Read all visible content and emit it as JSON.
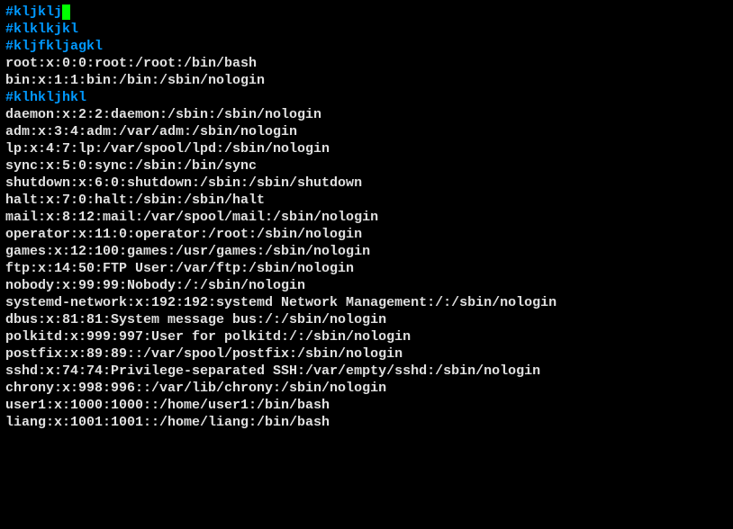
{
  "lines": [
    {
      "type": "comment",
      "text": "#kljklj",
      "hasCursor": true
    },
    {
      "type": "comment",
      "text": "#klklkjkl"
    },
    {
      "type": "comment",
      "text": "#kljfkljagkl"
    },
    {
      "type": "text",
      "text": "root:x:0:0:root:/root:/bin/bash"
    },
    {
      "type": "text",
      "text": "bin:x:1:1:bin:/bin:/sbin/nologin"
    },
    {
      "type": "comment",
      "text": "#klhkljhkl"
    },
    {
      "type": "text",
      "text": "daemon:x:2:2:daemon:/sbin:/sbin/nologin"
    },
    {
      "type": "text",
      "text": "adm:x:3:4:adm:/var/adm:/sbin/nologin"
    },
    {
      "type": "text",
      "text": "lp:x:4:7:lp:/var/spool/lpd:/sbin/nologin"
    },
    {
      "type": "text",
      "text": "sync:x:5:0:sync:/sbin:/bin/sync"
    },
    {
      "type": "text",
      "text": "shutdown:x:6:0:shutdown:/sbin:/sbin/shutdown"
    },
    {
      "type": "text",
      "text": "halt:x:7:0:halt:/sbin:/sbin/halt"
    },
    {
      "type": "text",
      "text": "mail:x:8:12:mail:/var/spool/mail:/sbin/nologin"
    },
    {
      "type": "text",
      "text": "operator:x:11:0:operator:/root:/sbin/nologin"
    },
    {
      "type": "text",
      "text": "games:x:12:100:games:/usr/games:/sbin/nologin"
    },
    {
      "type": "text",
      "text": "ftp:x:14:50:FTP User:/var/ftp:/sbin/nologin"
    },
    {
      "type": "text",
      "text": "nobody:x:99:99:Nobody:/:/sbin/nologin"
    },
    {
      "type": "text",
      "text": "systemd-network:x:192:192:systemd Network Management:/:/sbin/nologin"
    },
    {
      "type": "text",
      "text": "dbus:x:81:81:System message bus:/:/sbin/nologin"
    },
    {
      "type": "text",
      "text": "polkitd:x:999:997:User for polkitd:/:/sbin/nologin"
    },
    {
      "type": "text",
      "text": "postfix:x:89:89::/var/spool/postfix:/sbin/nologin"
    },
    {
      "type": "text",
      "text": "sshd:x:74:74:Privilege-separated SSH:/var/empty/sshd:/sbin/nologin"
    },
    {
      "type": "text",
      "text": "chrony:x:998:996::/var/lib/chrony:/sbin/nologin"
    },
    {
      "type": "text",
      "text": "user1:x:1000:1000::/home/user1:/bin/bash"
    },
    {
      "type": "text",
      "text": "liang:x:1001:1001::/home/liang:/bin/bash"
    }
  ]
}
